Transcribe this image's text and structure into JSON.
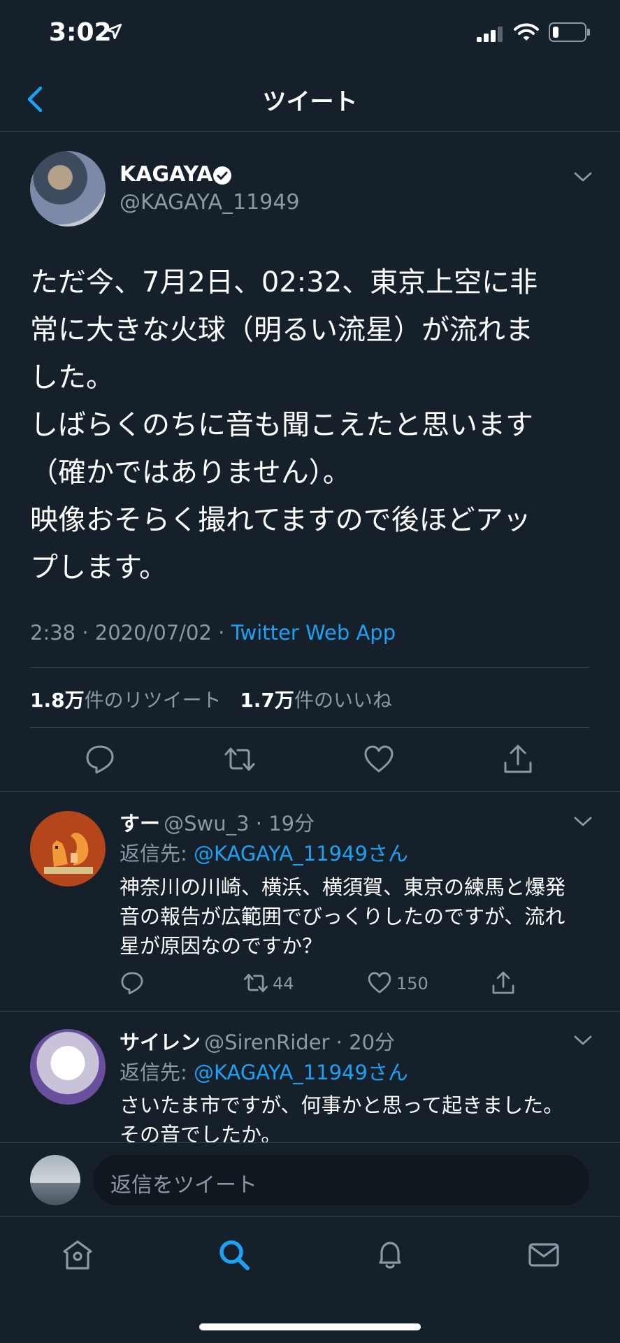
{
  "status": {
    "time": "3:02"
  },
  "header": {
    "title": "ツイート"
  },
  "tweet": {
    "name": "KAGAYA",
    "handle": "@KAGAYA_11949",
    "text": "ただ今、7月2日、02:32、東京上空に非\n常に大きな火球（明るい流星）が流れま\nした。\nしばらくのちに音も聞こえたと思います\n（確かではありません）。\n映像おそらく撮れてますので後ほどアッ\nプします。",
    "time": "2:38 · 2020/07/02 · ",
    "source": "Twitter Web App",
    "retweets_count": "1.8万",
    "retweets_label": "件のリツイート",
    "likes_count": "1.7万",
    "likes_label": "件のいいね"
  },
  "replies": [
    {
      "name": "すー",
      "handle": "@Swu_3 · 19分",
      "reply_prefix": "返信先: ",
      "reply_to": "@KAGAYA_11949さん",
      "text": "神奈川の川崎、横浜、横須賀、東京の練馬と爆発\n音の報告が広範囲でびっくりしたのですが、流れ\n星が原因なのですか？",
      "retweets": "44",
      "likes": "150"
    },
    {
      "name": "サイレン",
      "handle": "@SirenRider · 20分",
      "reply_prefix": "返信先: ",
      "reply_to": "@KAGAYA_11949さん",
      "text": "さいたま市ですが、何事かと思って起きました。\nその音でしたか。"
    }
  ],
  "compose": {
    "placeholder": "返信をツイート"
  },
  "colors": {
    "background": "#15202b",
    "accent": "#1da1f2",
    "secondary_text": "#8b98a5",
    "divider": "#38444d"
  },
  "battery_level": 0.2
}
